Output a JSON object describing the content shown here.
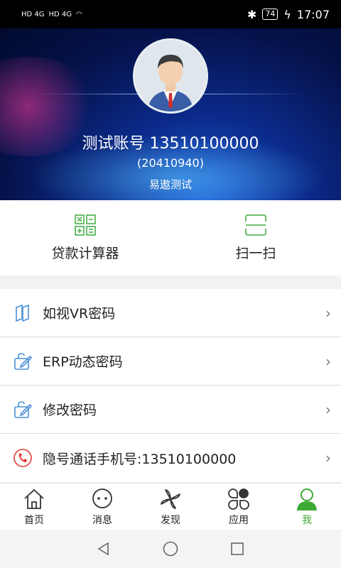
{
  "status_bar": {
    "network1": "HD 4G",
    "network2": "HD 4G",
    "battery": "74",
    "time": "17:07"
  },
  "profile": {
    "account_line": "测试账号 13510100000",
    "code": "(20410940)",
    "company": "易遨测试"
  },
  "tools": [
    {
      "label": "贷款计算器",
      "icon": "calculator-icon"
    },
    {
      "label": "扫一扫",
      "icon": "scan-icon"
    }
  ],
  "menu": [
    {
      "label": "如视VR密码",
      "icon": "vr-icon"
    },
    {
      "label": "ERP动态密码",
      "icon": "edit-lock-icon"
    },
    {
      "label": "修改密码",
      "icon": "edit-lock-icon"
    },
    {
      "label": "隐号通话手机号:13510100000",
      "icon": "phone-icon"
    }
  ],
  "tabs": [
    {
      "label": "首页",
      "icon": "home-icon"
    },
    {
      "label": "消息",
      "icon": "message-icon"
    },
    {
      "label": "发现",
      "icon": "discover-icon"
    },
    {
      "label": "应用",
      "icon": "apps-icon"
    },
    {
      "label": "我",
      "icon": "me-icon",
      "active": true
    }
  ],
  "colors": {
    "accent": "#3daa35",
    "tool_icon": "#5cb85c",
    "menu_icon": "#4a8fd6",
    "phone_icon": "#e53935"
  }
}
